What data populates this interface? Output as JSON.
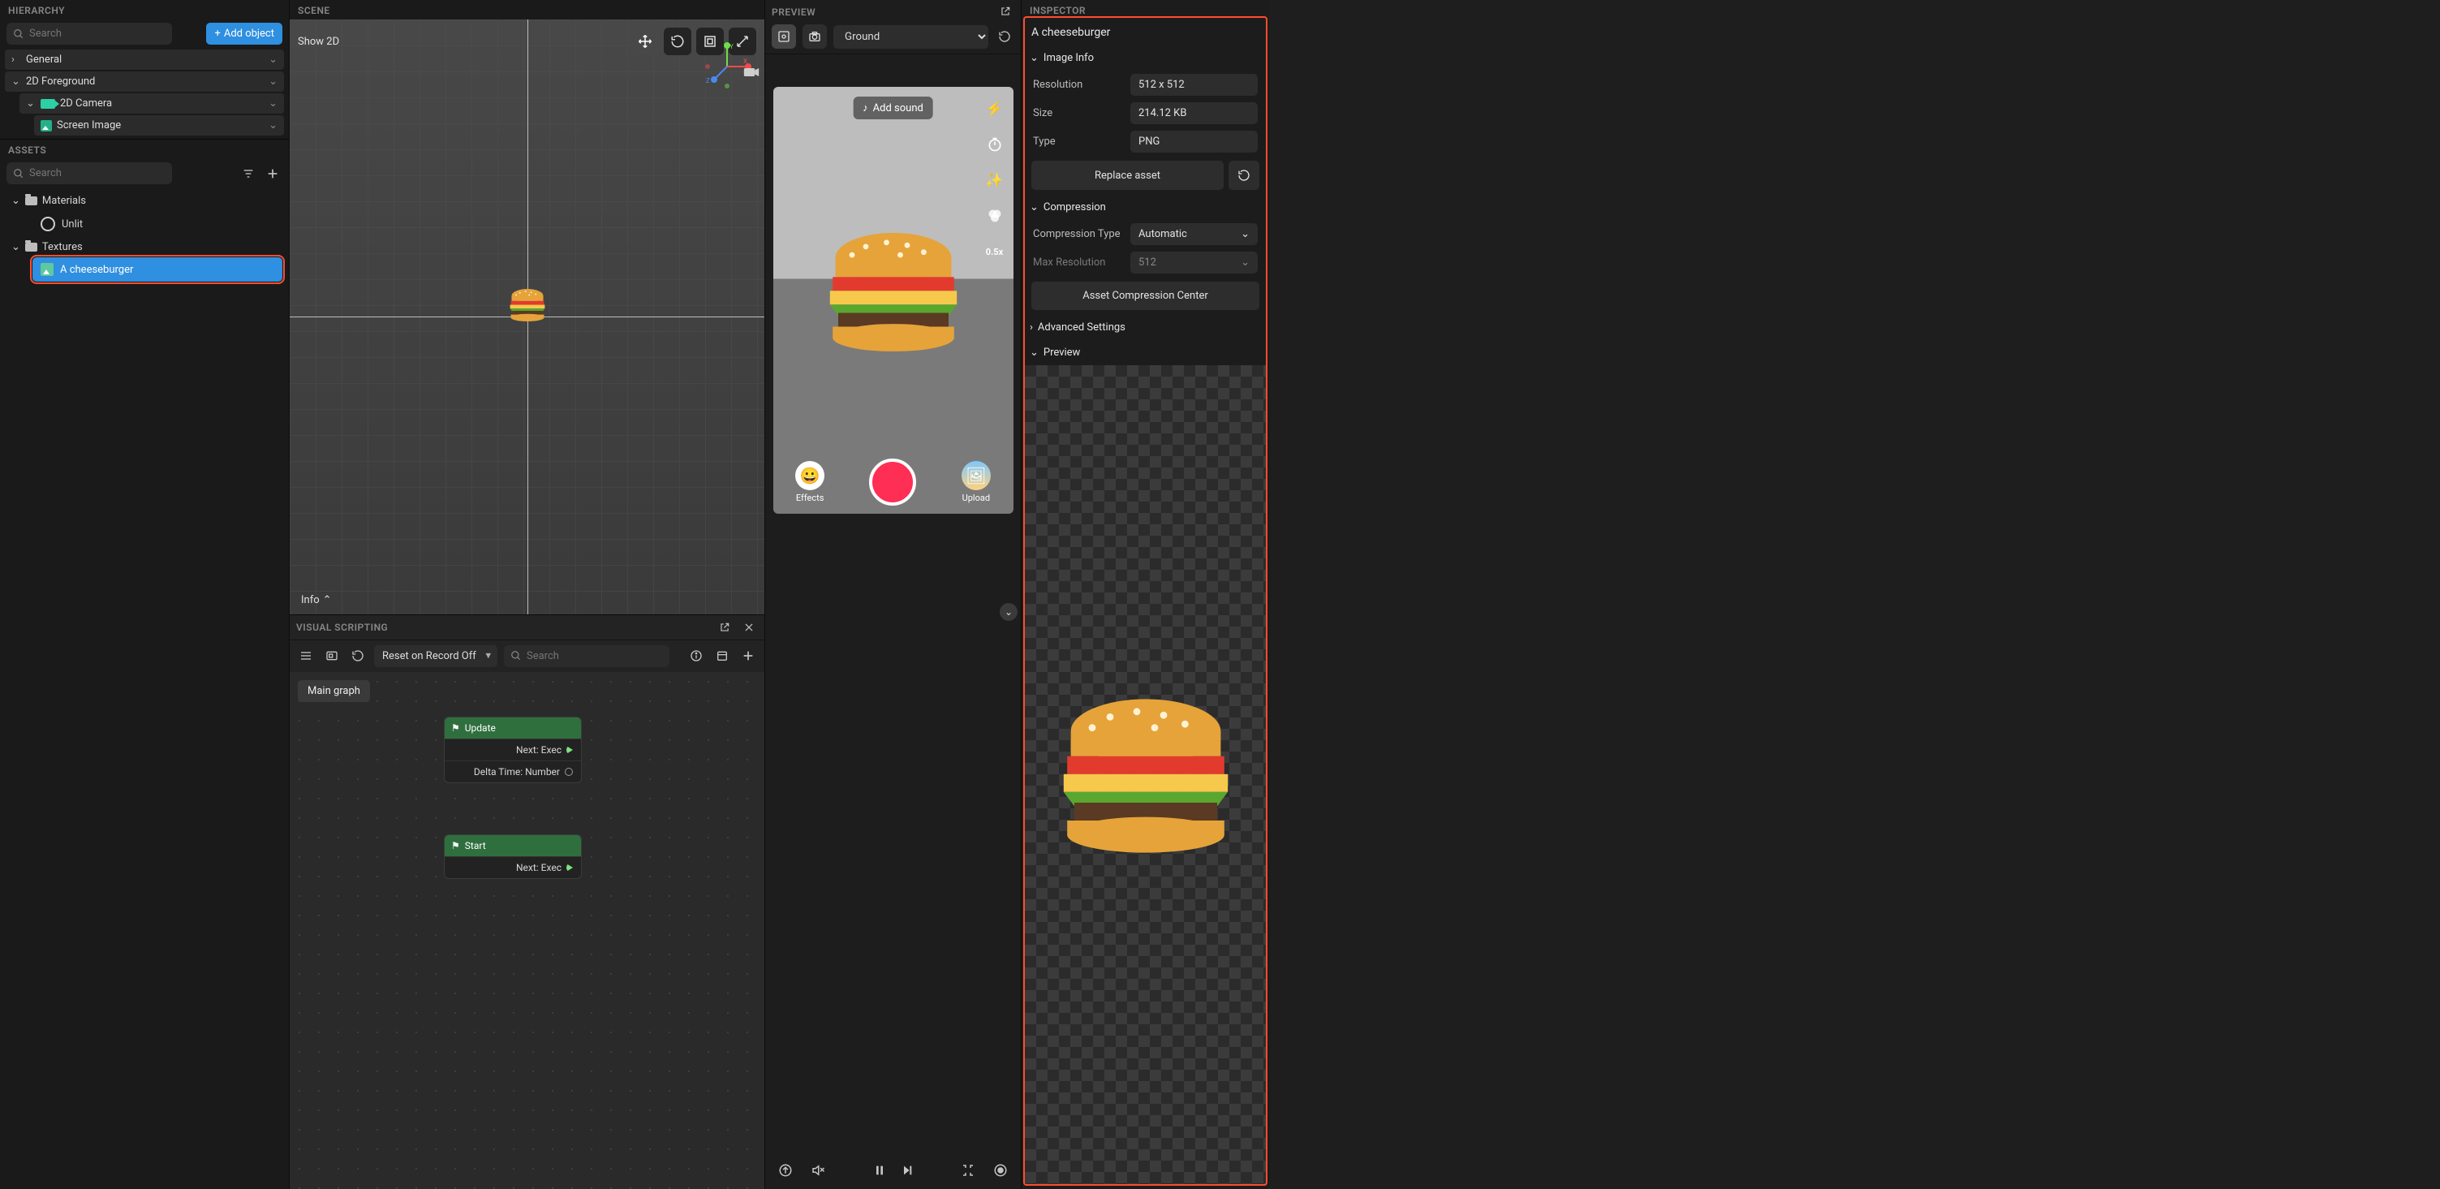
{
  "hierarchy": {
    "title": "HIERARCHY",
    "search_placeholder": "Search",
    "add_object": "Add object",
    "items": [
      {
        "label": "General",
        "depth": 0,
        "icon": "chevron"
      },
      {
        "label": "2D Foreground",
        "depth": 0,
        "icon": "chevron"
      },
      {
        "label": "2D Camera",
        "depth": 1,
        "icon": "camera"
      },
      {
        "label": "Screen Image",
        "depth": 2,
        "icon": "image"
      }
    ]
  },
  "assets": {
    "title": "ASSETS",
    "search_placeholder": "Search",
    "folders": [
      {
        "label": "Materials",
        "children": [
          {
            "label": "Unlit",
            "type": "unlit"
          }
        ]
      },
      {
        "label": "Textures",
        "children": [
          {
            "label": "A cheeseburger",
            "type": "texture",
            "selected": true
          }
        ]
      }
    ]
  },
  "scene": {
    "title": "SCENE",
    "show_2d": "Show 2D",
    "info": "Info",
    "gizmo": {
      "x": "X",
      "y": "Y",
      "z": "Z"
    }
  },
  "visual_scripting": {
    "title": "VISUAL SCRIPTING",
    "reset_option": "Reset on Record Off",
    "search_placeholder": "Search",
    "main_tab": "Main graph",
    "nodes": [
      {
        "title": "Update",
        "rows": [
          {
            "label": "Next: Exec",
            "port": "tri"
          },
          {
            "label": "Delta Time: Number",
            "port": "circle"
          }
        ]
      },
      {
        "title": "Start",
        "rows": [
          {
            "label": "Next: Exec",
            "port": "tri"
          }
        ]
      }
    ]
  },
  "preview": {
    "title": "PREVIEW",
    "mode": "Ground",
    "add_sound": "Add sound",
    "speed_label": "0.5x",
    "effects": "Effects",
    "upload": "Upload"
  },
  "inspector": {
    "title": "INSPECTOR",
    "asset_name": "A cheeseburger",
    "sections": {
      "image_info": {
        "title": "Image Info",
        "resolution_k": "Resolution",
        "resolution_v": "512 x 512",
        "size_k": "Size",
        "size_v": "214.12 KB",
        "type_k": "Type",
        "type_v": "PNG",
        "replace": "Replace asset"
      },
      "compression": {
        "title": "Compression",
        "type_k": "Compression Type",
        "type_v": "Automatic",
        "maxres_k": "Max Resolution",
        "maxres_v": "512",
        "center": "Asset Compression Center"
      },
      "advanced": {
        "title": "Advanced Settings"
      },
      "preview": {
        "title": "Preview"
      }
    }
  }
}
